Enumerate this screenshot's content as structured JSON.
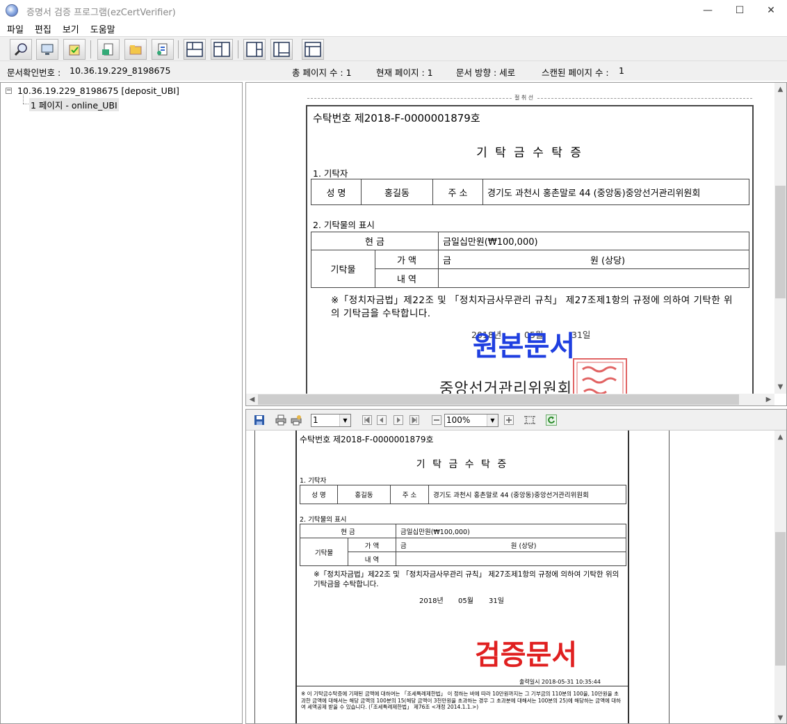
{
  "window": {
    "title": "증명서 검증 프로그램(ezCertVerifier)",
    "minimize": "—",
    "maximize": "☐",
    "close": "✕"
  },
  "menu": [
    "파일",
    "편집",
    "보기",
    "도움말"
  ],
  "status": {
    "doc_id_label": "문서확인번호 :",
    "doc_id": "10.36.19.229_8198675",
    "total_pages": "총 페이지 수 : 1",
    "current_page": "현재 페이지 : 1",
    "orientation": "문서 방향 : 세로",
    "scanned_pages": "스캔된 페이지 수 :",
    "scanned_pages_value": "1"
  },
  "tree": {
    "root": "10.36.19.229_8198675 [deposit_UBI]",
    "child": "1 페이지 - online_UBI",
    "toggle": "−"
  },
  "document": {
    "receipt_no": "수탁번호  제2018-F-0000001879호",
    "title": "기 탁 금 수 탁 증",
    "section1": "1. 기탁자",
    "name_label": "성  명",
    "name_value": "홍길동",
    "addr_label": "주  소",
    "addr_value": "경기도 과천시 홍촌말로 44  (중앙동)중앙선거관리위원회",
    "section2": "2. 기탁물의 표시",
    "cash_label": "현       금",
    "cash_value": "금일십만원(₩100,000)",
    "item_label": "기탁물",
    "value_label": "가  액",
    "value_prefix": "금",
    "value_suffix": "원 (상당)",
    "detail_label": "내  역",
    "note": "※「정치자금법」제22조 및 「정치자금사무관리 규칙」 제27조제1항의 규정에 의하여 기탁한 위의 기탁금을 수탁합니다.",
    "date_year": "2018년",
    "date_month": "05월",
    "date_day": "31일",
    "issuer": "중앙선거관리위원회",
    "cut_line": "절 취 선",
    "print_time": "출력일시  2018-05-31  10:35:44",
    "footnote": "※ 이 기탁금수탁증에 기재된 금액에 대하여는 「조세특례제한법」 이 정하는 바에 따라 10만원까지는 그 기부금의 110분의 100을, 10만원을 초과한 금액에 대해서는 해당 금액의 100분의 15(해당 금액이 3천만원을 초과하는 경우 그 초과분에 대해서는 100분의 25)에 해당하는 금액에 대하여 세액공제 받을 수 있습니다. (「조세특례제한법」 제76조 <개정 2014.1.1.>)"
  },
  "labels": {
    "original": "원본문서",
    "verified": "검증문서"
  },
  "viewer": {
    "page_value": "1",
    "zoom_value": "100%"
  },
  "colors": {
    "original_label": "#1f3fe0",
    "verified_label": "#e02020",
    "seal": "#d83030"
  }
}
